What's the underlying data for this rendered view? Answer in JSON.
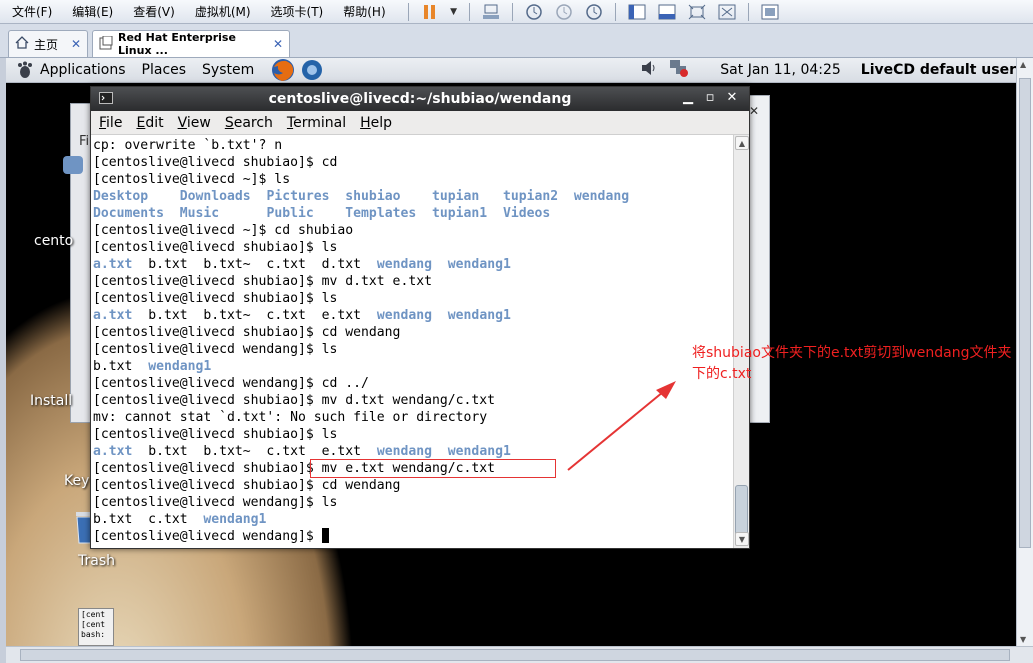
{
  "host": {
    "menu": [
      "文件(F)",
      "编辑(E)",
      "查看(V)",
      "虚拟机(M)",
      "选项卡(T)",
      "帮助(H)"
    ],
    "tabs": [
      {
        "label": "主页",
        "icon": "home-icon"
      },
      {
        "label": "Red Hat Enterprise Linux ...",
        "icon": "vm-icon"
      }
    ]
  },
  "guest_panel": {
    "menu": [
      "Applications",
      "Places",
      "System"
    ],
    "clock": "Sat Jan 11, 04:25",
    "user": "LiveCD default user"
  },
  "desktop": {
    "labels": {
      "centos": "cento",
      "install": "Install",
      "key": "Key",
      "trash": "Trash"
    },
    "mini_terminal": [
      "[cent",
      "[cent",
      "bash:"
    ]
  },
  "terminal": {
    "title": "centoslive@livecd:~/shubiao/wendang",
    "menu": [
      "File",
      "Edit",
      "View",
      "Search",
      "Terminal",
      "Help"
    ],
    "lines": [
      [
        {
          "t": "cp: overwrite `b.txt'? n"
        }
      ],
      [
        {
          "t": "[centoslive@livecd shubiao]$ cd"
        }
      ],
      [
        {
          "t": "[centoslive@livecd ~]$ ls"
        }
      ],
      [
        {
          "t": "Desktop    ",
          "c": "dir"
        },
        {
          "t": "Downloads  ",
          "c": "dir"
        },
        {
          "t": "Pictures  ",
          "c": "dir"
        },
        {
          "t": "shubiao    ",
          "c": "dir"
        },
        {
          "t": "tupian   ",
          "c": "dir"
        },
        {
          "t": "tupian2  ",
          "c": "dir"
        },
        {
          "t": "wendang",
          "c": "dir"
        }
      ],
      [
        {
          "t": "Documents  ",
          "c": "dir"
        },
        {
          "t": "Music      ",
          "c": "dir"
        },
        {
          "t": "Public    ",
          "c": "dir"
        },
        {
          "t": "Templates  ",
          "c": "dir"
        },
        {
          "t": "tupian1  ",
          "c": "dir"
        },
        {
          "t": "Videos",
          "c": "dir"
        }
      ],
      [
        {
          "t": "[centoslive@livecd ~]$ cd shubiao"
        }
      ],
      [
        {
          "t": "[centoslive@livecd shubiao]$ ls"
        }
      ],
      [
        {
          "t": "a.txt",
          "c": "dir"
        },
        {
          "t": "  b.txt  b.txt~  c.txt  d.txt  "
        },
        {
          "t": "wendang",
          "c": "dir"
        },
        {
          "t": "  "
        },
        {
          "t": "wendang1",
          "c": "dir"
        }
      ],
      [
        {
          "t": "[centoslive@livecd shubiao]$ mv d.txt e.txt"
        }
      ],
      [
        {
          "t": "[centoslive@livecd shubiao]$ ls"
        }
      ],
      [
        {
          "t": "a.txt",
          "c": "dir"
        },
        {
          "t": "  b.txt  b.txt~  c.txt  e.txt  "
        },
        {
          "t": "wendang",
          "c": "dir"
        },
        {
          "t": "  "
        },
        {
          "t": "wendang1",
          "c": "dir"
        }
      ],
      [
        {
          "t": "[centoslive@livecd shubiao]$ cd wendang"
        }
      ],
      [
        {
          "t": "[centoslive@livecd wendang]$ ls"
        }
      ],
      [
        {
          "t": "b.txt  "
        },
        {
          "t": "wendang1",
          "c": "dir"
        }
      ],
      [
        {
          "t": "[centoslive@livecd wendang]$ cd ../"
        }
      ],
      [
        {
          "t": "[centoslive@livecd shubiao]$ mv d.txt wendang/c.txt"
        }
      ],
      [
        {
          "t": "mv: cannot stat `d.txt': No such file or directory"
        }
      ],
      [
        {
          "t": "[centoslive@livecd shubiao]$ ls"
        }
      ],
      [
        {
          "t": "a.txt",
          "c": "dir"
        },
        {
          "t": "  b.txt  b.txt~  c.txt  e.txt  "
        },
        {
          "t": "wendang",
          "c": "dir"
        },
        {
          "t": "  "
        },
        {
          "t": "wendang1",
          "c": "dir"
        }
      ],
      [
        {
          "t": "[centoslive@livecd shubiao]$ mv e.txt wendang/c.txt"
        }
      ],
      [
        {
          "t": "[centoslive@livecd shubiao]$ cd wendang"
        }
      ],
      [
        {
          "t": "[centoslive@livecd wendang]$ ls"
        }
      ],
      [
        {
          "t": "b.txt  c.txt  "
        },
        {
          "t": "wendang1",
          "c": "dir"
        }
      ],
      [
        {
          "t": "[centoslive@livecd wendang]$ "
        }
      ]
    ],
    "dir_color": "#6f94c3"
  },
  "annotation": {
    "text": "将shubiao文件夹下的e.txt剪切到wendang文件夹下的c.txt",
    "color": "#ef2020"
  }
}
